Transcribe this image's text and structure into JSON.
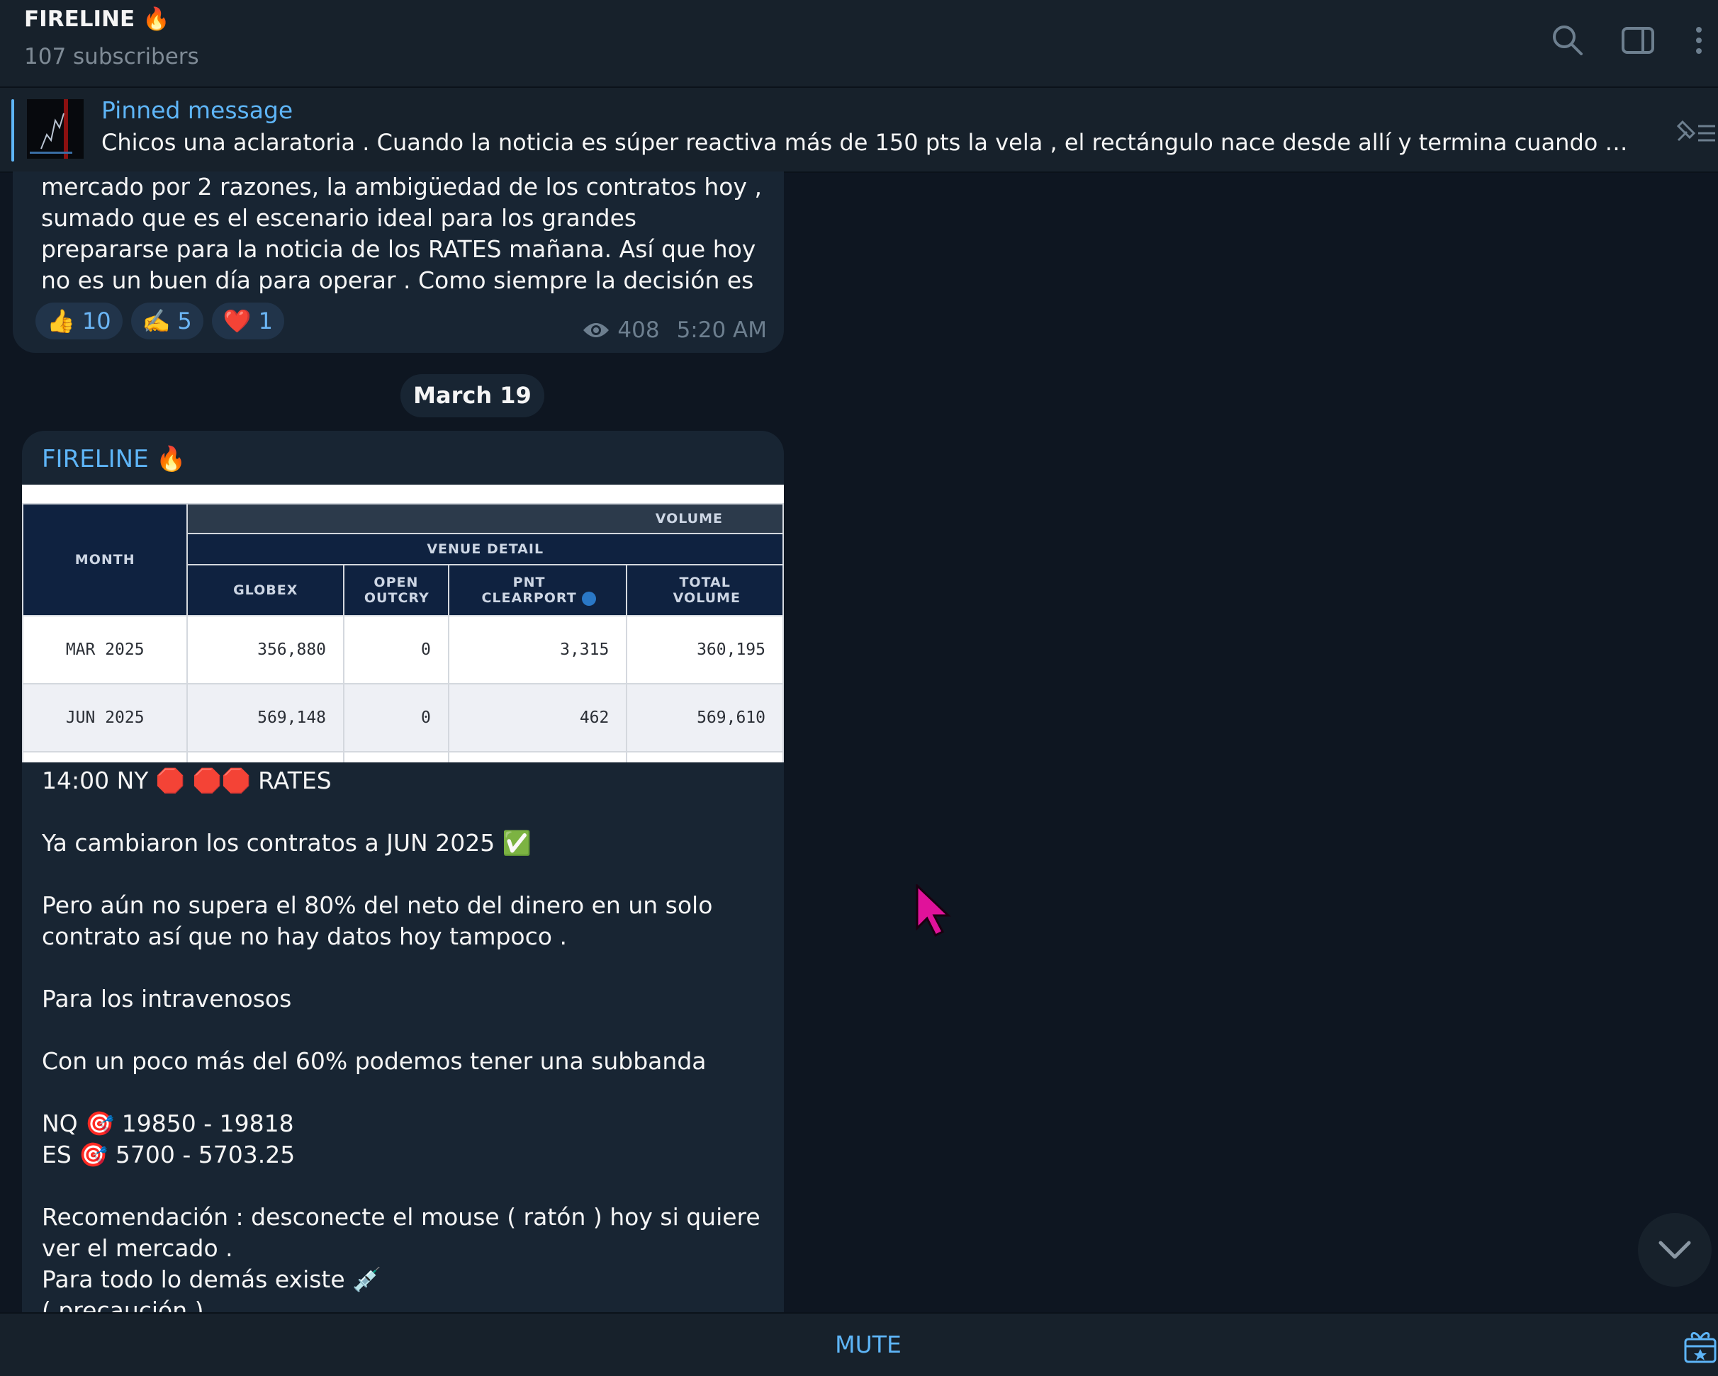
{
  "header": {
    "title": "FIRELINE 🔥",
    "subtitle": "107 subscribers"
  },
  "pinned": {
    "title": "Pinned message",
    "text": "Chicos una aclaratoria .  Cuando la noticia es súper reactiva más de 150 pts la vela , el rectángulo nace desde allí y termina cuando complete las..."
  },
  "message1": {
    "text": "mercado por 2 razones, la ambigüedad de los contratos hoy , sumado que es el escenario ideal para los grandes prepararse para la noticia de los RATES mañana. Así que hoy no es un buen día para operar . Como siempre la decisión es suya .",
    "reactions": [
      {
        "emoji": "👍",
        "count": "10"
      },
      {
        "emoji": "✍️",
        "count": "5"
      },
      {
        "emoji": "❤️",
        "count": "1"
      }
    ],
    "views": "408",
    "time": "5:20 AM"
  },
  "date_separator": "March 19",
  "message2": {
    "sender": "FIRELINE 🔥",
    "table": {
      "volume_label": "VOLUME",
      "venue_label": "VENUE DETAIL",
      "headers": [
        "MONTH",
        "GLOBEX",
        "OPEN OUTCRY",
        "PNT CLEARPORT",
        "TOTAL VOLUME"
      ],
      "rows": [
        [
          "MAR 2025",
          "356,880",
          "0",
          "3,315",
          "360,195"
        ],
        [
          "JUN 2025",
          "569,148",
          "0",
          "462",
          "569,610"
        ]
      ]
    },
    "lines": {
      "l1": "14:00 NY 🛑 🛑🛑 RATES",
      "l2": "Ya cambiaron los contratos a JUN 2025 ✅",
      "l3": "Pero aún no supera el 80% del neto del dinero en un solo contrato así que no hay datos hoy tampoco .",
      "l4": "Para los intravenosos",
      "l5": "Con un poco más del 60% podemos tener una subbanda",
      "l6": "NQ 🎯 19850 - 19818",
      "l7": "ES 🎯 5700 - 5703.25",
      "l8": "Recomendación : desconecte el mouse ( ratón ) hoy si quiere ver el mercado .",
      "l9": "Para todo lo demás existe 💉",
      "l10": "( precaución )"
    }
  },
  "bottom": {
    "mute_label": "MUTE"
  }
}
